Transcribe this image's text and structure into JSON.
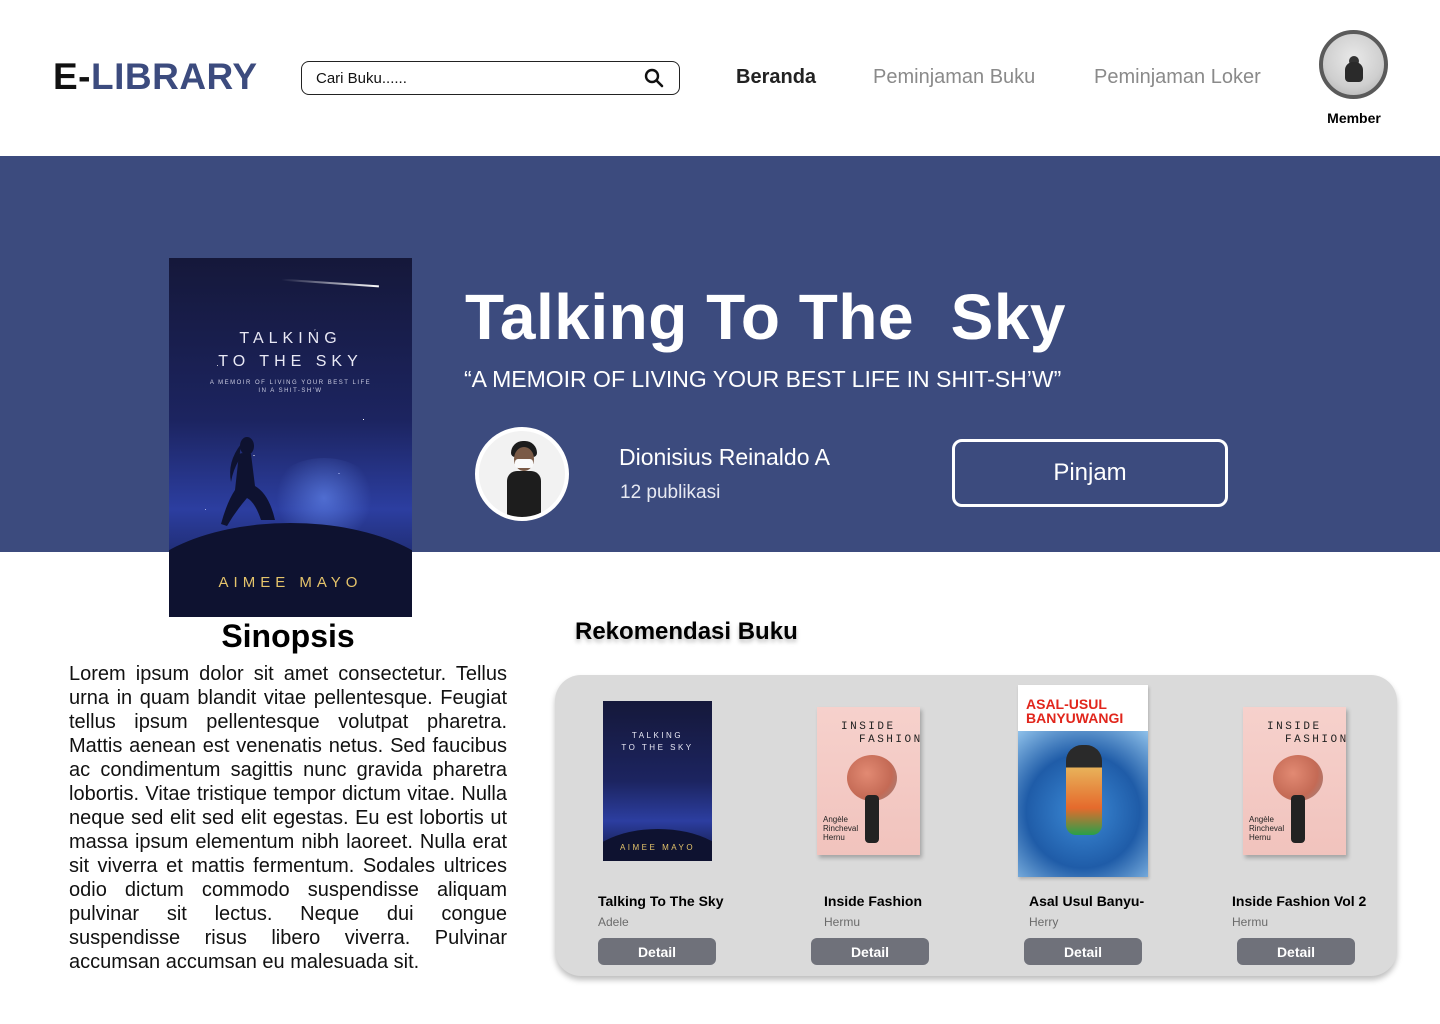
{
  "header": {
    "logo_prefix": "E-",
    "logo_main": "LIBRARY",
    "search_placeholder": "Cari Buku......",
    "nav": [
      {
        "label": "Beranda",
        "active": true
      },
      {
        "label": "Peminjaman Buku",
        "active": false
      },
      {
        "label": "Peminjaman Loker",
        "active": false
      }
    ],
    "user_role": "Member"
  },
  "book": {
    "title": "Talking To The  Sky",
    "subtitle": "“A MEMOIR OF LIVING YOUR BEST LIFE IN SHIT-SH’W”",
    "cover_title_line1": "TALKING",
    "cover_title_line2": "TO THE SKY",
    "cover_tagline": "A MEMOIR OF LIVING YOUR BEST LIFE IN A SHIT-SH'W",
    "cover_author": "AIMEE MAYO",
    "author_name": "Dionisius Reinaldo A",
    "publications": "12 publikasi",
    "borrow_label": "Pinjam"
  },
  "synopsis": {
    "heading": "Sinopsis",
    "text": "Lorem ipsum dolor sit amet consectetur. Tellus urna in quam blandit vitae pellentesque. Feugiat tellus ipsum pellentesque volutpat pharetra. Mattis aenean est venenatis netus. Sed faucibus ac condimentum sagittis nunc gravida pharetra lobortis. Vitae tristique tempor dictum vitae. Nulla neque sed elit sed elit egestas. Eu est lobortis ut massa ipsum elementum nibh laoreet. Nulla erat sit viverra et mattis fermentum. Sodales ultrices odio dictum commodo suspendisse aliquam pulvinar sit lectus. Neque dui congue suspendisse risus libero viverra. Pulvinar accumsan accumsan eu malesuada sit."
  },
  "recommendations": {
    "heading": "Rekomendasi Buku",
    "items": [
      {
        "title": "Talking To The Sky",
        "author": "Adele",
        "button": "Detail",
        "cover_line1": "TALKING",
        "cover_line2": "TO THE SKY",
        "cover_author": "AIMEE MAYO"
      },
      {
        "title": "Inside Fashion",
        "author": "Hermu",
        "button": "Detail",
        "cover_line1": "INSIDE",
        "cover_line2": "FASHION",
        "cover_author": "Angèle Rincheval Hernu"
      },
      {
        "title": "Asal Usul Banyu-",
        "author": "Herry",
        "button": "Detail",
        "cover_line1": "ASAL-USUL BANYUWANGI"
      },
      {
        "title": "Inside Fashion Vol 2",
        "author": "Hermu",
        "button": "Detail",
        "cover_line1": "INSIDE",
        "cover_line2": "FASHION",
        "cover_author": "Angèle Rincheval Hernu"
      }
    ]
  },
  "colors": {
    "brand": "#3c4b7e",
    "hero_bg": "#3c4b7e",
    "panel_bg": "#dadada",
    "detail_button": "#6f717a"
  }
}
